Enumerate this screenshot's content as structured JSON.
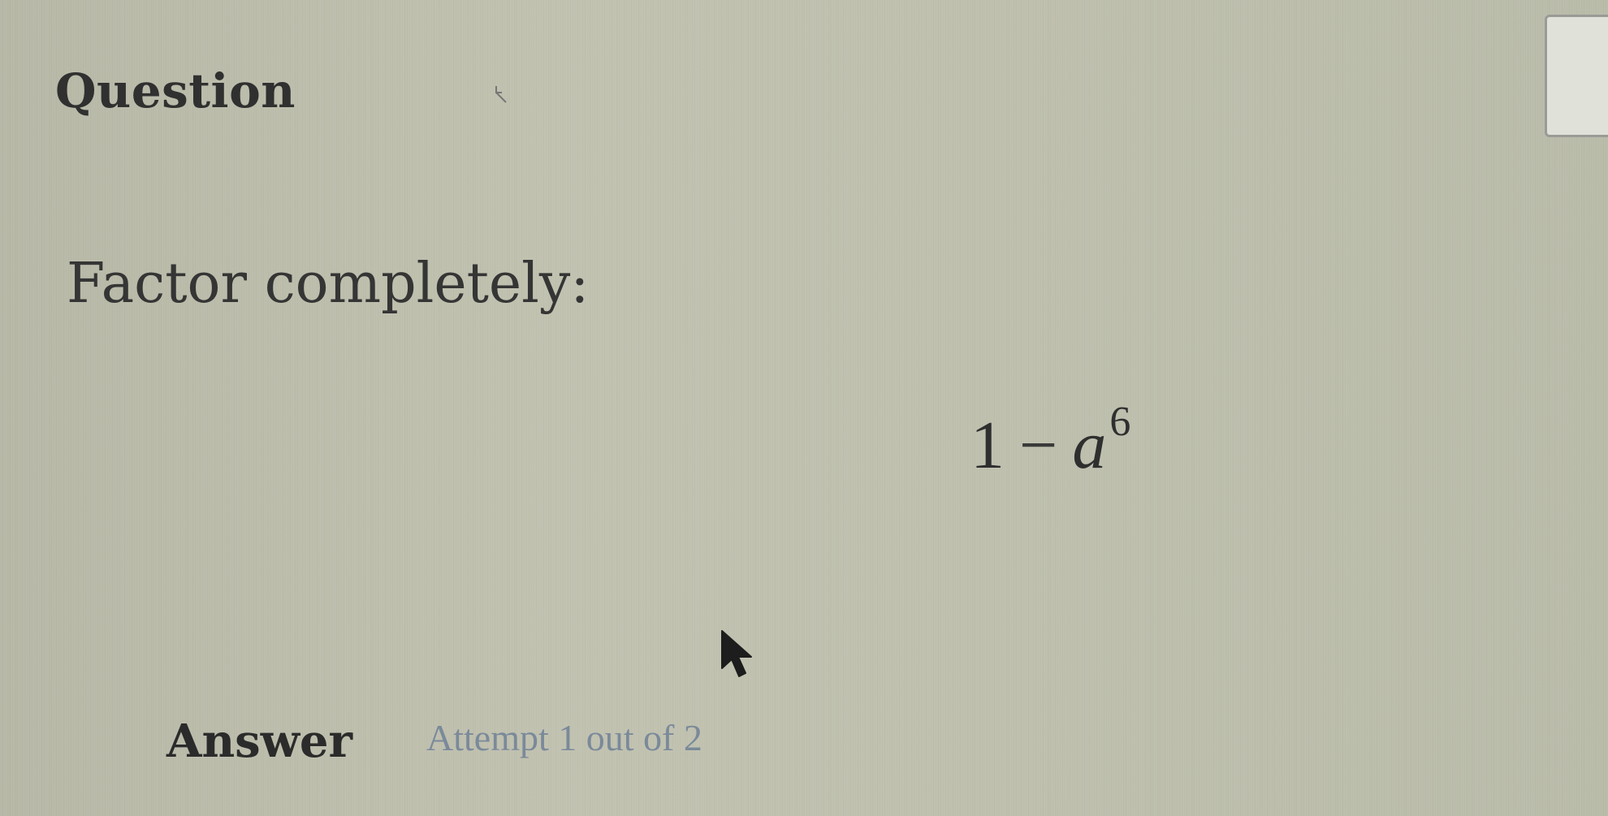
{
  "question": {
    "title": "Question",
    "prompt": "Factor completely:",
    "expression": {
      "constant": "1",
      "operator": "−",
      "variable": "a",
      "exponent": "6"
    }
  },
  "answer": {
    "label": "Answer",
    "attempt": "Attempt 1 out of 2"
  },
  "icons": {
    "cursor": "arrow-cursor-icon"
  },
  "colors": {
    "background": "#dcdcd2",
    "text": "#2b2b2b",
    "attempt_text": "#7a8a9a"
  }
}
